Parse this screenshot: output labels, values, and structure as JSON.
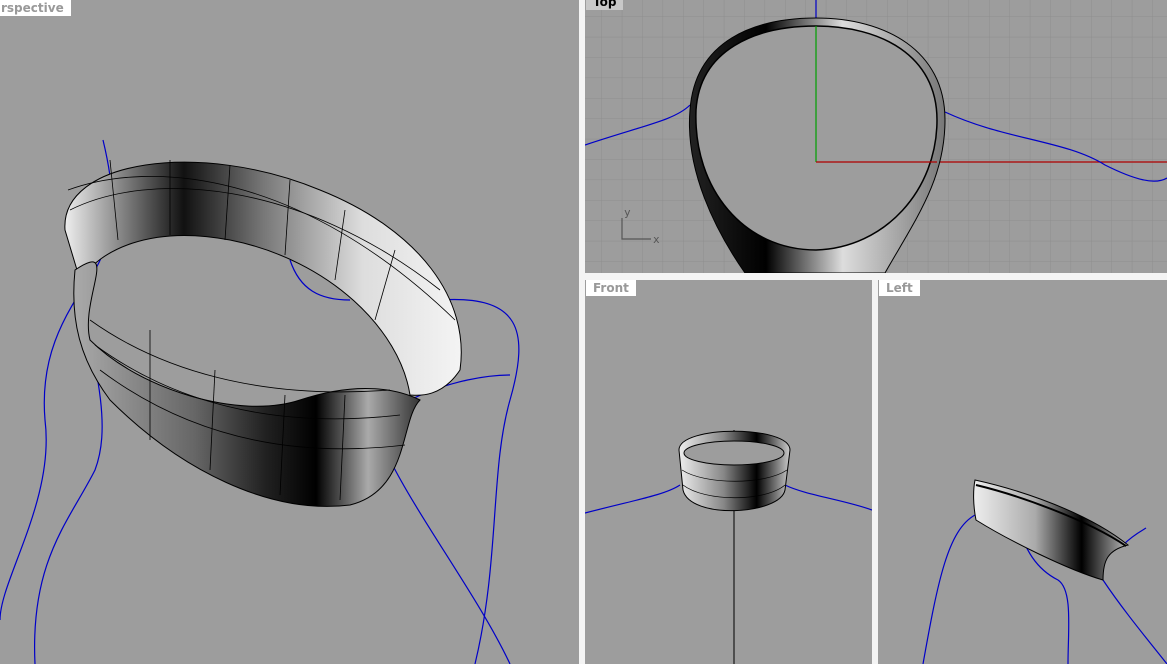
{
  "viewports": {
    "perspective": {
      "label": "rspective"
    },
    "top": {
      "label": "Top",
      "axis_x": "x",
      "axis_y": "y"
    },
    "front": {
      "label": "Front"
    },
    "left": {
      "label": "Left"
    }
  },
  "colors": {
    "background": "#9d9d9d",
    "curve": "#0000c8",
    "x_axis": "#b00000",
    "y_axis": "#00a000",
    "grid": "#8e8e8e"
  }
}
